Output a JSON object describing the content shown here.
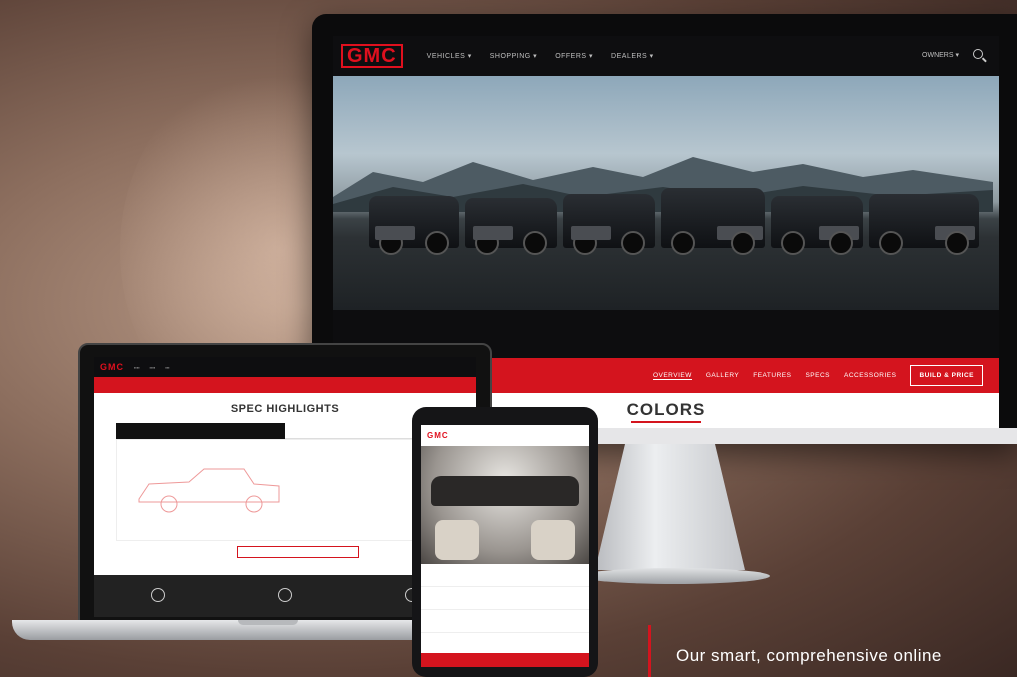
{
  "brand": {
    "logo_text": "GMC",
    "accent_color": "#d4141e"
  },
  "desktop": {
    "nav_items": [
      "VEHICLES ▾",
      "SHOPPING ▾",
      "OFFERS ▾",
      "DEALERS ▾"
    ],
    "owners_label": "OWNERS ▾",
    "subnav": [
      "OVERVIEW",
      "GALLERY",
      "FEATURES",
      "SPECS",
      "ACCESSORIES"
    ],
    "build_label": "BUILD & PRICE",
    "section_title": "COLORS"
  },
  "laptop": {
    "logo_text": "GMC",
    "section_title": "SPEC HIGHLIGHTS"
  },
  "tablet": {
    "logo_text": "GMC"
  },
  "caption": "Our smart, comprehensive online"
}
